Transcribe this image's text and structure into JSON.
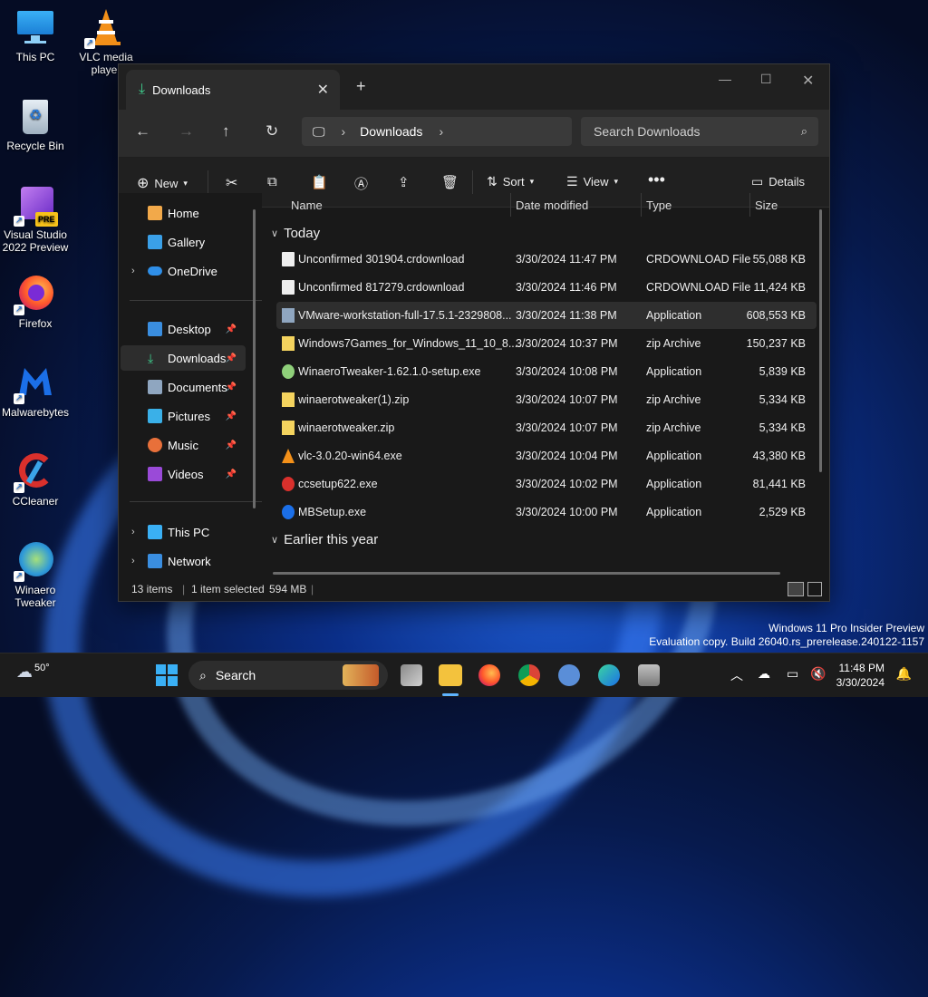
{
  "desktop": {
    "icons": [
      {
        "label": "This PC"
      },
      {
        "label": "VLC media player"
      },
      {
        "label": "Recycle Bin"
      },
      {
        "label": "Visual Studio 2022 Preview",
        "badge": "PRE"
      },
      {
        "label": "Firefox"
      },
      {
        "label": "Malwarebytes"
      },
      {
        "label": "CCleaner"
      },
      {
        "label": "Winaero Tweaker"
      }
    ],
    "watermark_line1": "Windows 11 Pro Insider Preview",
    "watermark_line2": "Evaluation copy. Build 26040.rs_prerelease.240122-1157"
  },
  "window": {
    "tab_title": "Downloads",
    "address_segment": "Downloads",
    "search_placeholder": "Search Downloads",
    "cmd": {
      "new": "New",
      "sort": "Sort",
      "view": "View",
      "details": "Details"
    },
    "sidebar": {
      "home": "Home",
      "gallery": "Gallery",
      "onedrive": "OneDrive",
      "desktop": "Desktop",
      "downloads": "Downloads",
      "documents": "Documents",
      "pictures": "Pictures",
      "music": "Music",
      "videos": "Videos",
      "thispc": "This PC",
      "network": "Network"
    },
    "columns": {
      "name": "Name",
      "date": "Date modified",
      "type": "Type",
      "size": "Size"
    },
    "groups": {
      "today": "Today",
      "earlier": "Earlier this year"
    },
    "files": [
      {
        "name": "Unconfirmed 301904.crdownload",
        "date": "3/30/2024 11:47 PM",
        "type": "CRDOWNLOAD File",
        "size": "55,088 KB"
      },
      {
        "name": "Unconfirmed 817279.crdownload",
        "date": "3/30/2024 11:46 PM",
        "type": "CRDOWNLOAD File",
        "size": "11,424 KB"
      },
      {
        "name": "VMware-workstation-full-17.5.1-2329808...",
        "date": "3/30/2024 11:38 PM",
        "type": "Application",
        "size": "608,553 KB"
      },
      {
        "name": "Windows7Games_for_Windows_11_10_8....",
        "date": "3/30/2024 10:37 PM",
        "type": "zip Archive",
        "size": "150,237 KB"
      },
      {
        "name": "WinaeroTweaker-1.62.1.0-setup.exe",
        "date": "3/30/2024 10:08 PM",
        "type": "Application",
        "size": "5,839 KB"
      },
      {
        "name": "winaerotweaker(1).zip",
        "date": "3/30/2024 10:07 PM",
        "type": "zip Archive",
        "size": "5,334 KB"
      },
      {
        "name": "winaerotweaker.zip",
        "date": "3/30/2024 10:07 PM",
        "type": "zip Archive",
        "size": "5,334 KB"
      },
      {
        "name": "vlc-3.0.20-win64.exe",
        "date": "3/30/2024 10:04 PM",
        "type": "Application",
        "size": "43,380 KB"
      },
      {
        "name": "ccsetup622.exe",
        "date": "3/30/2024 10:02 PM",
        "type": "Application",
        "size": "81,441 KB"
      },
      {
        "name": "MBSetup.exe",
        "date": "3/30/2024 10:00 PM",
        "type": "Application",
        "size": "2,529 KB"
      }
    ],
    "status": {
      "items": "13 items",
      "selected": "1 item selected",
      "size": "594 MB"
    }
  },
  "taskbar": {
    "weather": "50°",
    "search_label": "Search",
    "time": "11:48 PM",
    "date": "3/30/2024"
  }
}
